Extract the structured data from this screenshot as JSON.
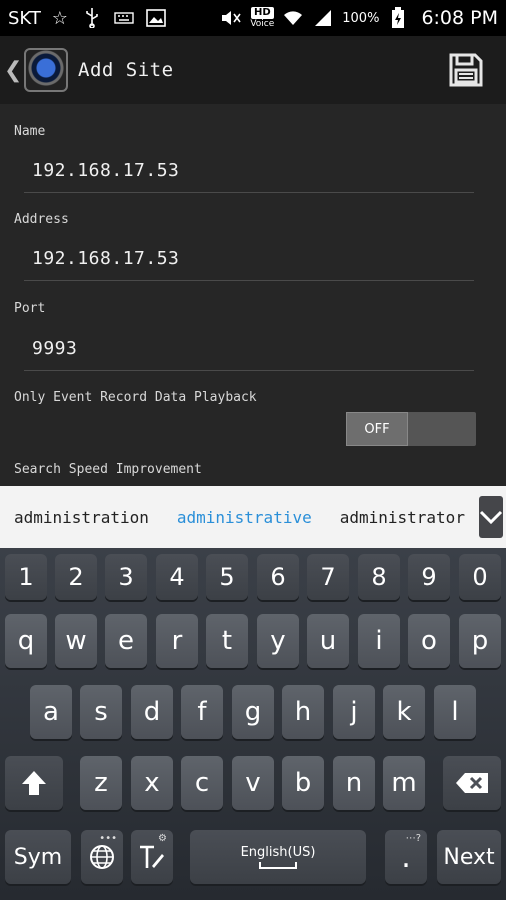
{
  "status_bar": {
    "carrier": "SKT",
    "hd_badge": "HD",
    "hd_voice": "Voice",
    "battery_pct": "100%",
    "time": "6:08 PM",
    "icons": [
      "star-icon",
      "usb-icon",
      "keyboard-icon",
      "image-icon",
      "mute-icon",
      "wifi-icon",
      "signal-icon",
      "battery-icon"
    ]
  },
  "action_bar": {
    "title": "Add Site"
  },
  "form": {
    "name_label": "Name",
    "name_value": "192.168.17.53",
    "address_label": "Address",
    "address_value": "192.168.17.53",
    "port_label": "Port",
    "port_value": "9993",
    "event_label": "Only Event Record Data Playback",
    "event_toggle": "OFF",
    "speed_label": "Search Speed Improvement"
  },
  "suggestions": [
    "administration",
    "administrative",
    "administrator"
  ],
  "keyboard": {
    "number_row": [
      "1",
      "2",
      "3",
      "4",
      "5",
      "6",
      "7",
      "8",
      "9",
      "0"
    ],
    "row1": [
      "q",
      "w",
      "e",
      "r",
      "t",
      "y",
      "u",
      "i",
      "o",
      "p"
    ],
    "row2": [
      "a",
      "s",
      "d",
      "f",
      "g",
      "h",
      "j",
      "k",
      "l"
    ],
    "row3": [
      "z",
      "x",
      "c",
      "v",
      "b",
      "n",
      "m"
    ],
    "sym_label": "Sym",
    "space_label": "English(US)",
    "period_label": ".",
    "next_label": "Next"
  },
  "colors": {
    "form_bg": "#262626",
    "suggest_selected": "#2a8fd8",
    "key_bg": "#53575e"
  }
}
